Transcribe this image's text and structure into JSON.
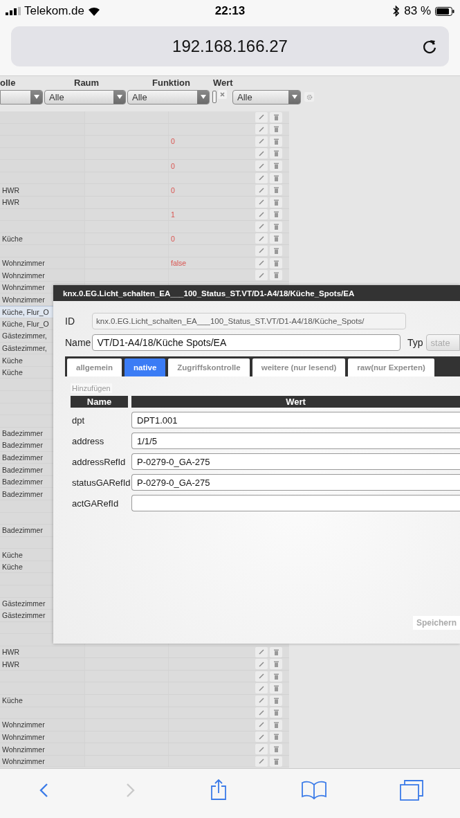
{
  "status_bar": {
    "carrier": "Telekom.de",
    "time": "22:13",
    "battery": "83 %"
  },
  "address_bar": {
    "url": "192.168.166.27"
  },
  "table": {
    "columns": [
      "olle",
      "Raum",
      "Funktion",
      "Wert"
    ],
    "filters": [
      {
        "kind": "select"
      },
      {
        "kind": "select",
        "value": "Alle"
      },
      {
        "kind": "select",
        "value": "Alle"
      },
      {
        "kind": "box"
      },
      {
        "kind": "clear"
      },
      {
        "kind": "select",
        "value": "Alle"
      },
      {
        "kind": "gear"
      }
    ],
    "rows": [
      {
        "selected": false
      },
      {
        "selected": false
      },
      {
        "column_3": "0",
        "selected": false
      },
      {
        "selected": false
      },
      {
        "column_3": "0",
        "selected": false
      },
      {
        "selected": false
      },
      {
        "column_1": "HWR",
        "column_3": "0",
        "selected": false
      },
      {
        "column_1": "HWR",
        "selected": false
      },
      {
        "column_3": "1",
        "selected": false
      },
      {
        "selected": false
      },
      {
        "column_1": "Küche",
        "column_3": "0",
        "selected": false
      },
      {
        "selected": false
      },
      {
        "column_1": "Wohnzimmer",
        "column_3": "false",
        "selected": false
      },
      {
        "column_1": "Wohnzimmer",
        "selected": false
      },
      {
        "column_1": "Wohnzimmer",
        "selected": false
      },
      {
        "column_1": "Wohnzimmer",
        "selected": false
      },
      {
        "column_1": "Küche, Flur_O",
        "selected": true
      },
      {
        "column_1": "Küche, Flur_O",
        "selected": false
      },
      {
        "column_1": "Gästezimmer,",
        "selected": false
      },
      {
        "column_1": "Gästezimmer,",
        "selected": false
      },
      {
        "column_1": "Küche",
        "selected": false
      },
      {
        "column_1": "Küche",
        "selected": false
      },
      {
        "selected": false
      },
      {
        "selected": false
      },
      {
        "selected": false
      },
      {
        "selected": false
      },
      {
        "column_1": "Badezimmer",
        "selected": false
      },
      {
        "column_1": "Badezimmer",
        "selected": false
      },
      {
        "column_1": "Badezimmer",
        "selected": false
      },
      {
        "column_1": "Badezimmer",
        "selected": false
      },
      {
        "column_1": "Badezimmer",
        "selected": false
      },
      {
        "column_1": "Badezimmer",
        "selected": false
      },
      {
        "selected": false
      },
      {
        "selected": false
      },
      {
        "column_1": "Badezimmer",
        "selected": false
      },
      {
        "selected": false
      },
      {
        "column_1": "Küche",
        "selected": false
      },
      {
        "column_1": "Küche",
        "selected": false
      },
      {
        "selected": false
      },
      {
        "selected": false
      },
      {
        "column_1": "Gästezimmer",
        "selected": false
      },
      {
        "column_1": "Gästezimmer",
        "selected": false
      },
      {
        "selected": false
      },
      {
        "selected": false
      },
      {
        "column_1": "HWR",
        "selected": false
      },
      {
        "column_1": "HWR",
        "selected": false
      },
      {
        "selected": false
      },
      {
        "selected": false
      },
      {
        "column_1": "Küche",
        "selected": false
      },
      {
        "selected": false
      },
      {
        "column_1": "Wohnzimmer",
        "selected": false
      },
      {
        "column_1": "Wohnzimmer",
        "selected": false
      },
      {
        "column_1": "Wohnzimmer",
        "selected": false
      },
      {
        "column_1": "Wohnzimmer",
        "selected": false
      }
    ]
  },
  "dialog": {
    "title": "knx.0.EG.Licht_schalten_EA___100_Status_ST.VT/D1-A4/18/Küche_Spots/EA",
    "id_label": "ID",
    "id_value": "knx.0.EG.Licht_schalten_EA___100_Status_ST.VT/D1-A4/18/Küche_Spots/",
    "name_label": "Name",
    "name_value": "VT/D1-A4/18/Küche Spots/EA",
    "type_label": "Typ",
    "type_value": "state",
    "tabs": [
      {
        "label": "allgemein",
        "selected": false
      },
      {
        "label": "native",
        "selected": true
      },
      {
        "label": "Zugriffskontrolle",
        "selected": false
      },
      {
        "label": "weitere (nur lesend)",
        "selected": false
      },
      {
        "label": "raw(nur Experten)",
        "selected": false
      }
    ],
    "add_button": "Hinzufügen",
    "columns": [
      "Name",
      "Wert"
    ],
    "fields": [
      {
        "name": "dpt",
        "value": "DPT1.001"
      },
      {
        "name": "address",
        "value": "1/1/5"
      },
      {
        "name": "addressRefId",
        "value": "P-0279-0_GA-275"
      },
      {
        "name": "statusGARefId",
        "value": "P-0279-0_GA-275"
      },
      {
        "name": "actGARefId"
      }
    ],
    "save_button": "Speichern"
  },
  "toolbar": [
    {
      "kind": "back",
      "disabled": false
    },
    {
      "kind": "forward",
      "disabled": true
    },
    {
      "kind": "share",
      "disabled": false
    },
    {
      "kind": "bookmarks",
      "disabled": false
    },
    {
      "kind": "tabs",
      "disabled": false
    }
  ]
}
